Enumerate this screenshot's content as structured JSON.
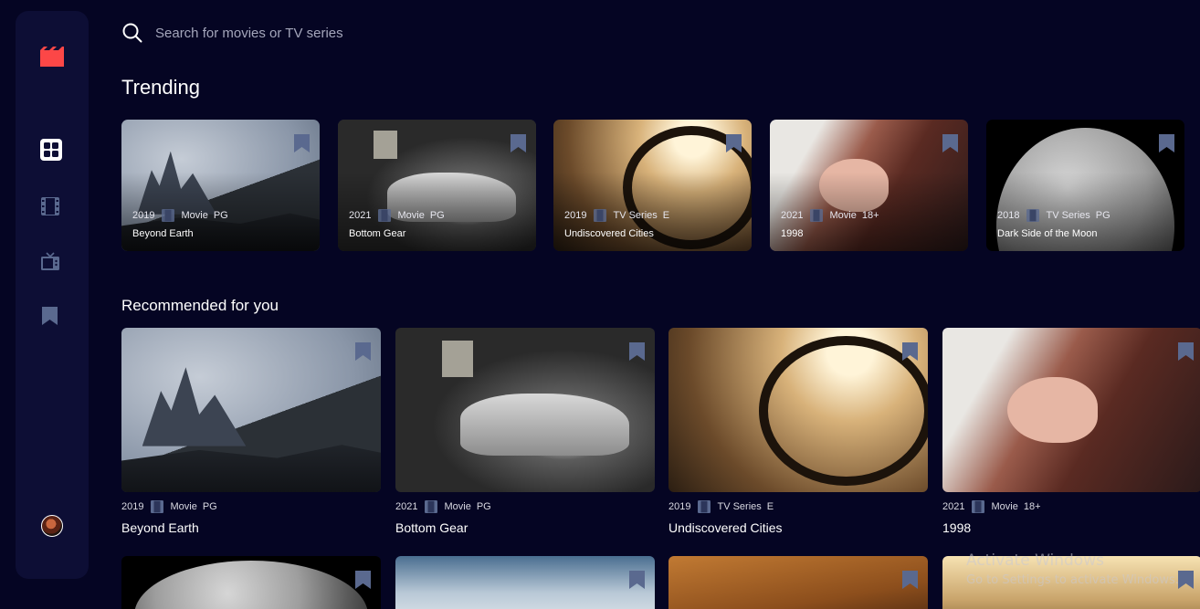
{
  "search": {
    "placeholder": "Search for movies or TV series"
  },
  "sidebar": {
    "logo_icon": "clapperboard-icon",
    "items": [
      {
        "name": "home",
        "icon": "grid-icon",
        "active": true
      },
      {
        "name": "movies",
        "icon": "film-icon",
        "active": false
      },
      {
        "name": "tv-series",
        "icon": "tv-icon",
        "active": false
      },
      {
        "name": "bookmarks",
        "icon": "bookmark-icon",
        "active": false
      }
    ]
  },
  "colors": {
    "background": "#050523",
    "sidebar": "#0d0e35",
    "accent": "#fc4747",
    "icon_inactive": "#5a698f"
  },
  "trending": {
    "title": "Trending",
    "items": [
      {
        "year": "2019",
        "category": "Movie",
        "rating": "PG",
        "title": "Beyond Earth"
      },
      {
        "year": "2021",
        "category": "Movie",
        "rating": "PG",
        "title": "Bottom Gear"
      },
      {
        "year": "2019",
        "category": "TV Series",
        "rating": "E",
        "title": "Undiscovered Cities"
      },
      {
        "year": "2021",
        "category": "Movie",
        "rating": "18+",
        "title": "1998"
      },
      {
        "year": "2018",
        "category": "TV Series",
        "rating": "PG",
        "title": "Dark Side of the Moon"
      }
    ]
  },
  "recommended": {
    "title": "Recommended for you",
    "items": [
      {
        "year": "2019",
        "category": "Movie",
        "rating": "PG",
        "title": "Beyond Earth"
      },
      {
        "year": "2021",
        "category": "Movie",
        "rating": "PG",
        "title": "Bottom Gear"
      },
      {
        "year": "2019",
        "category": "TV Series",
        "rating": "E",
        "title": "Undiscovered Cities"
      },
      {
        "year": "2021",
        "category": "Movie",
        "rating": "18+",
        "title": "1998"
      }
    ]
  },
  "watermark": {
    "title": "Activate Windows",
    "subtitle": "Go to Settings to activate Windows."
  }
}
